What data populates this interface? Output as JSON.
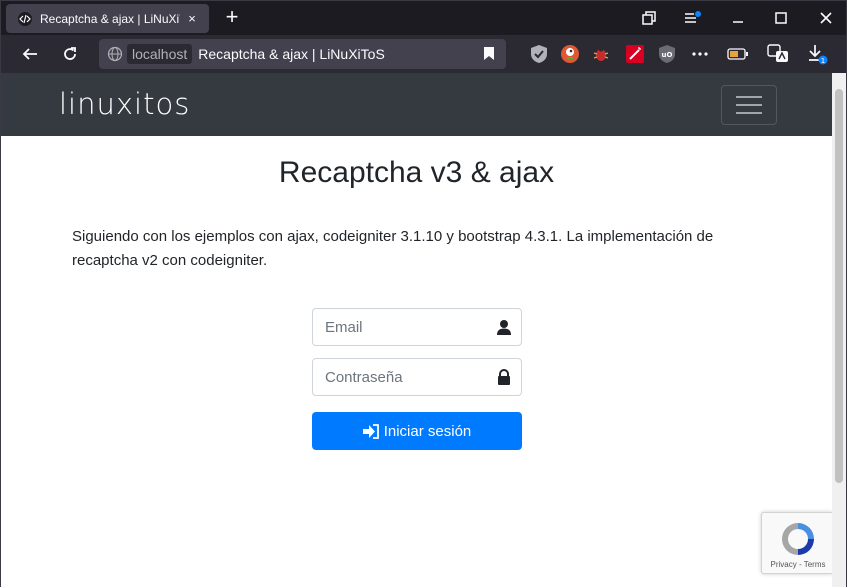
{
  "browser": {
    "tab_title": "Recaptcha & ajax | LiNuXiToS",
    "tab_close": "×",
    "new_tab": "+",
    "url_host": "localhost",
    "url_title": "Recaptcha & ajax | LiNuXiToS",
    "downloads_badge": "1"
  },
  "site": {
    "brand": "linuxitos",
    "page_title": "Recaptcha v3 & ajax",
    "intro": "Siguiendo con los ejemplos con ajax, codeigniter 3.1.10 y bootstrap 4.3.1. La implementación de recaptcha v2 con codeigniter.",
    "email_placeholder": "Email",
    "password_placeholder": "Contraseña",
    "submit_label": "Iniciar sesión",
    "recaptcha_terms": "Privacy - Terms"
  },
  "colors": {
    "navbar_dark": "#343a40",
    "primary": "#007bff",
    "browser_bg": "#1c1b22"
  }
}
